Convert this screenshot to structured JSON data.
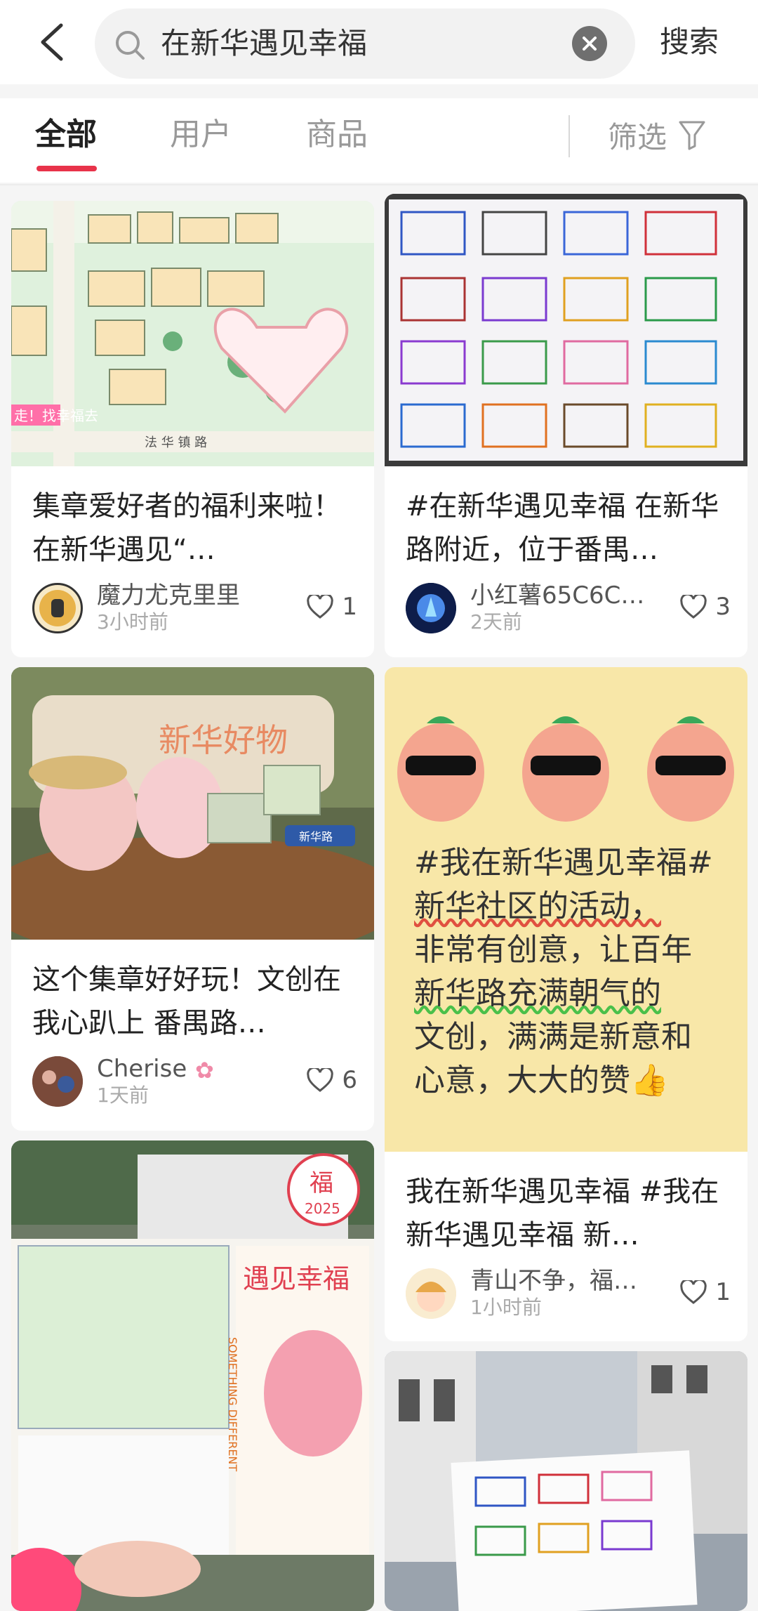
{
  "search": {
    "query": "在新华遇见幸福",
    "button_label": "搜索"
  },
  "tabs": [
    {
      "label": "全部"
    },
    {
      "label": "用户"
    },
    {
      "label": "商品"
    }
  ],
  "filter_label": "筛选",
  "accent_color": "#e8334a",
  "cards": [
    {
      "title": "集章爱好者的福利来啦！ 在新华遇见“…",
      "user": "魔力尤克里里",
      "time": "3小时前",
      "likes": "1",
      "image_text": {
        "road": "法 华 镇 路",
        "sign": "走！找幸福去"
      }
    },
    {
      "title": "#在新华遇见幸福 在新华路附近，位于番禺…",
      "user": "小红薯65C6C82E",
      "time": "2天前",
      "likes": "3"
    },
    {
      "title": "这个集章好好玩！文创在我心趴上 番禺路…",
      "user": "Cherise",
      "time": "1天前",
      "likes": "6",
      "image_text": {
        "bag": "新华好物",
        "tag": "新华路"
      }
    },
    {
      "title": "我在新华遇见幸福 #我在新华遇见幸福 新…",
      "user": "青山不争，福…",
      "time": "1小时前",
      "likes": "1",
      "image_text": {
        "line1": "#我在新华遇见幸福#",
        "line2": "新华社区的活动，",
        "line3": "非常有创意，让百年",
        "line4": "新华路充满朝气的",
        "line5": "文创，满满是新意和",
        "line6": "心意，大大的赞👍"
      }
    },
    {
      "image_text": {
        "badge": "福",
        "badge_year": "2025",
        "headline": "遇见幸福",
        "side": "SOMETHING DIFFERENT"
      }
    },
    {}
  ]
}
